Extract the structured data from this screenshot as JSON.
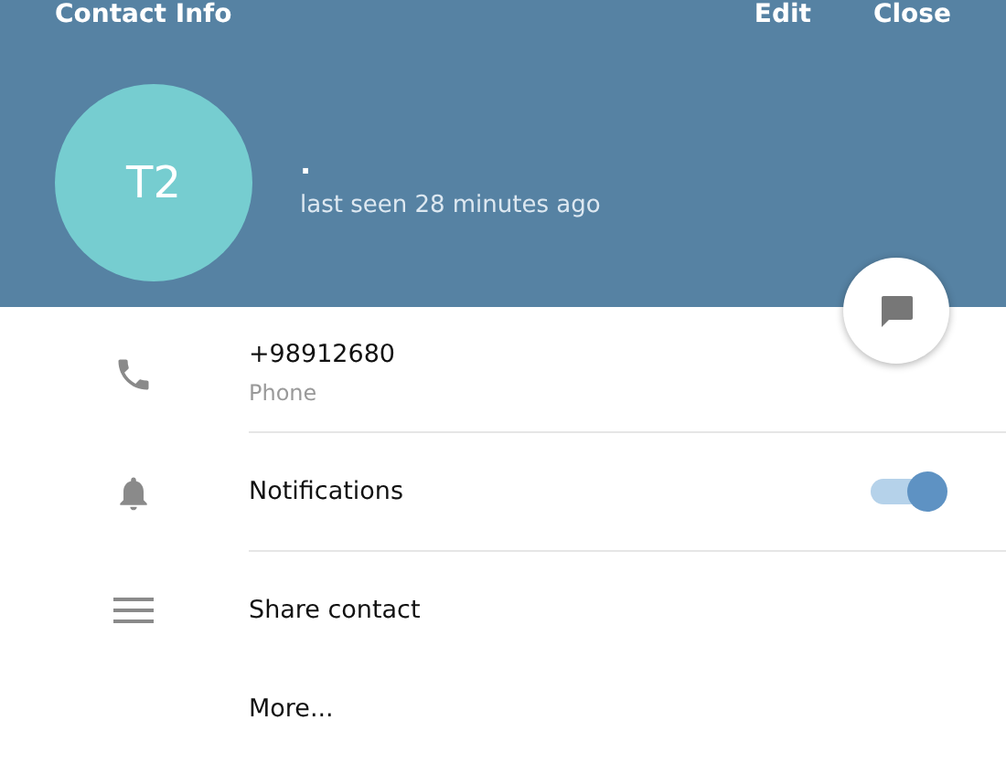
{
  "header": {
    "title": "Contact Info",
    "actions": [
      "Edit",
      "Close"
    ],
    "avatar_initials": "T2",
    "name": ".",
    "status": "last seen 28 minutes ago"
  },
  "rows": [
    {
      "kind": "phone",
      "value": "+98912680",
      "caption": "Phone"
    },
    {
      "kind": "toggle",
      "value": "Notifications",
      "on": true
    },
    {
      "kind": "share",
      "value": "Share contact"
    },
    {
      "kind": "plain",
      "value": "More..."
    }
  ]
}
